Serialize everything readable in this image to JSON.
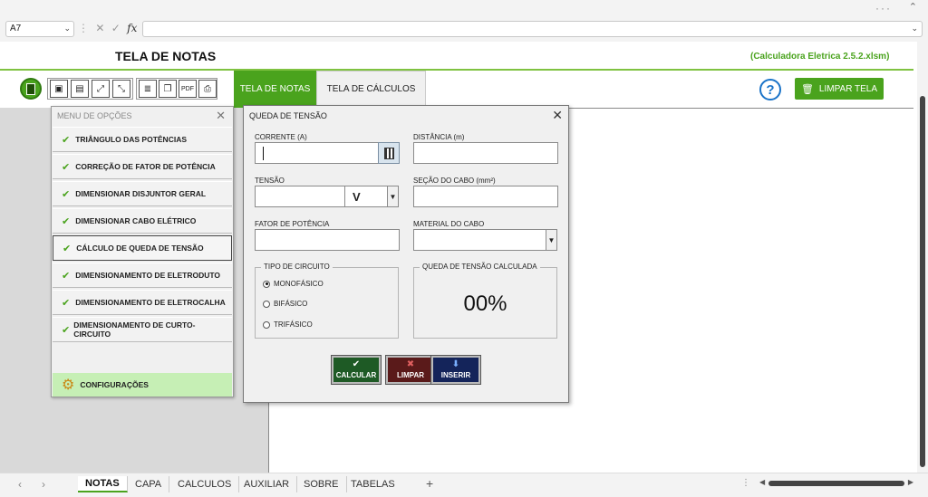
{
  "formula_bar": {
    "cell_ref": "A7",
    "cancel": "✕",
    "enter": "✓",
    "fx": "fx",
    "formula": ""
  },
  "header": {
    "title": "TELA DE NOTAS",
    "filename": "(Calculadora Eletrica 2.5.2.xlsm)"
  },
  "toolbar": {
    "tab_notas": "TELA DE NOTAS",
    "tab_calculos": "TELA DE CÁLCULOS",
    "help": "?",
    "limpar_tela": "LIMPAR TELA"
  },
  "menu": {
    "title": "MENU DE OPÇÕES",
    "close": "✕",
    "items": [
      {
        "label": "TRIÂNGULO DAS POTÊNCIAS"
      },
      {
        "label": "CORREÇÃO DE FATOR DE POTÊNCIA"
      },
      {
        "label": "DIMENSIONAR DISJUNTOR GERAL"
      },
      {
        "label": "DIMENSIONAR CABO ELÉTRICO"
      },
      {
        "label": "CÁLCULO DE QUEDA DE TENSÃO"
      },
      {
        "label": "DIMENSIONAMENTO DE ELETRODUTO"
      },
      {
        "label": "DIMENSIONAMENTO DE ELETROCALHA"
      },
      {
        "label": "DIMENSIONAMENTO DE CURTO-CIRCUITO"
      }
    ],
    "config": "CONFIGURAÇÕES"
  },
  "dialog": {
    "title": "QUEDA DE TENSÃO",
    "close": "✕",
    "corrente_label": "CORRENTE (A)",
    "distancia_label": "DISTÂNCIA (m)",
    "tensao_label": "TENSÃO",
    "tensao_unit": "V",
    "secao_label": "SEÇÃO DO CABO (mm²)",
    "fator_label": "FATOR DE POTÊNCIA",
    "material_label": "MATERIAL DO CABO",
    "tipo_circuito_label": "TIPO DE CIRCUITO",
    "radio_mono": "MONOFÁSICO",
    "radio_bi": "BIFÁSICO",
    "radio_tri": "TRIFÁSICO",
    "queda_label": "QUEDA DE TENSÃO CALCULADA",
    "queda_value": "00%",
    "btn_calcular": "CALCULAR",
    "btn_limpar": "LIMPAR",
    "btn_inserir": "INSERIR"
  },
  "sheet_tabs": [
    "NOTAS",
    "CAPA",
    "CALCULOS",
    "AUXILIAR",
    "SOBRE",
    "TABELAS"
  ],
  "colors": {
    "accent_green": "#4aa31d",
    "calc_btn": "#1e5a25",
    "limpar_btn": "#5a1a1a",
    "inserir_btn": "#14245a",
    "help_blue": "#1a73c8"
  }
}
